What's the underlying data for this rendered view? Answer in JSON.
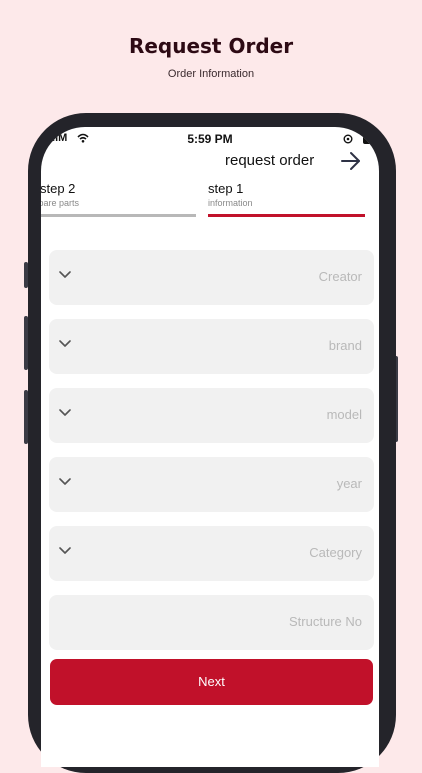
{
  "page": {
    "title": "Request Order",
    "subtitle": "Order Information"
  },
  "status_bar": {
    "time": "5:59 PM",
    "signal": "ıılM"
  },
  "header": {
    "title": "request order",
    "back_icon": "arrow-right-icon"
  },
  "steps": [
    {
      "title": "step 2",
      "subtitle": "spare parts",
      "active": false
    },
    {
      "title": "step 1",
      "subtitle": "information",
      "active": true
    }
  ],
  "fields": [
    {
      "placeholder": "Creator",
      "has_dropdown": true
    },
    {
      "placeholder": "brand",
      "has_dropdown": true
    },
    {
      "placeholder": "model",
      "has_dropdown": true
    },
    {
      "placeholder": "year",
      "has_dropdown": true
    },
    {
      "placeholder": "Category",
      "has_dropdown": true
    },
    {
      "placeholder": "Structure No",
      "has_dropdown": false
    }
  ],
  "next_button": {
    "label": "Next"
  },
  "colors": {
    "accent": "#c1112a",
    "background": "#fde9ea",
    "field_bg": "#f1f1f1",
    "inactive_line": "#b8b8b8"
  }
}
